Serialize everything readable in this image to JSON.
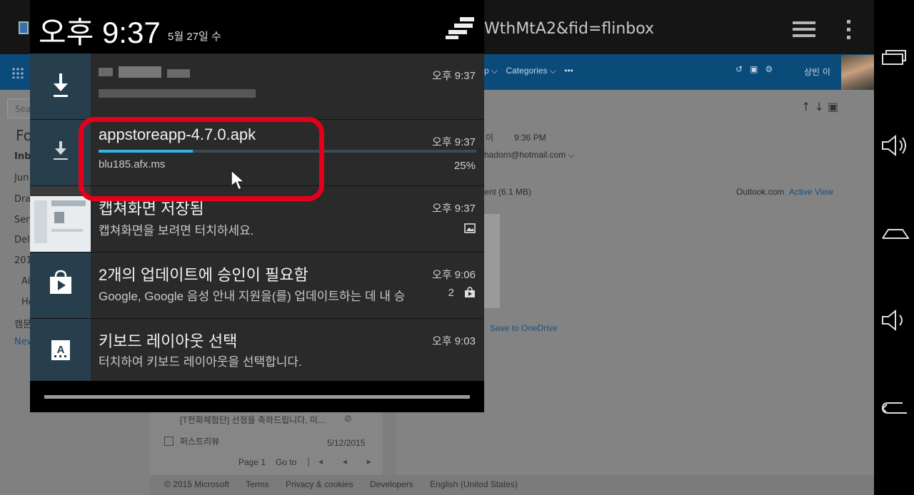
{
  "browser": {
    "url_fragment": "WthMtA2&fid=flinbox"
  },
  "outlook": {
    "top_menu": [
      "p ⌵",
      "Categories ⌵",
      "•••"
    ],
    "user_name": "상빈 이",
    "search_placeholder": "Sea",
    "folders_heading": "Fo",
    "folders": [
      "Inbo",
      "Jun",
      "Dra",
      "Sen",
      "Del",
      "201",
      "Ai",
      "He",
      "캠문",
      "New"
    ],
    "sender_line": "이",
    "sender_time": "9:36 PM",
    "sender_email": "hadorri@hotmail.com ⌵",
    "attachment_label": "ent (6.1 MB)",
    "outlook_label": "Outlook.com",
    "active_view": "Active View",
    "save_onedrive": "Save to OneDrive",
    "list_items": [
      {
        "subject": "[T전화체험단] 선정을 축하드립니다, 미...",
        "date": ""
      },
      {
        "subject": "퍼스트리뷰",
        "date": "5/12/2015"
      }
    ],
    "pager": {
      "page": "Page 1",
      "goto": "Go to"
    },
    "footer": [
      "© 2015 Microsoft",
      "Terms",
      "Privacy & cookies",
      "Developers",
      "English (United States)"
    ]
  },
  "status": {
    "clock": "오후 9:37",
    "date": "5월 27일 수"
  },
  "notifications": [
    {
      "id": "download-1",
      "title": "",
      "text": "",
      "time": "오후 9:37",
      "icon": "download-icon"
    },
    {
      "id": "download-apk",
      "title": "appstoreapp-4.7.0.apk",
      "text": "blu185.afx.ms",
      "time": "오후 9:37",
      "progress_label": "25%",
      "progress": 0.25,
      "icon": "download-icon"
    },
    {
      "id": "screenshot",
      "title": "캡쳐화면 저장됨",
      "text": "캡쳐화면을 보려면 터치하세요.",
      "time": "오후 9:37",
      "icon": "image-icon"
    },
    {
      "id": "updates",
      "title": "2개의 업데이트에 승인이 필요함",
      "text": "Google, Google 음성 안내 지원을(를) 업데이트하는 데 내 승",
      "time": "오후 9:06",
      "count": "2",
      "icon": "play-store-icon"
    },
    {
      "id": "keyboard",
      "title": "키보드 레이아웃 선택",
      "text": "터치하여 키보드 레이아웃을 선택합니다.",
      "time": "오후 9:03",
      "icon": "keyboard-icon"
    }
  ],
  "colors": {
    "highlight": "#e3001a",
    "progress": "#33b5e5",
    "icon_bg": "#273e4d"
  }
}
